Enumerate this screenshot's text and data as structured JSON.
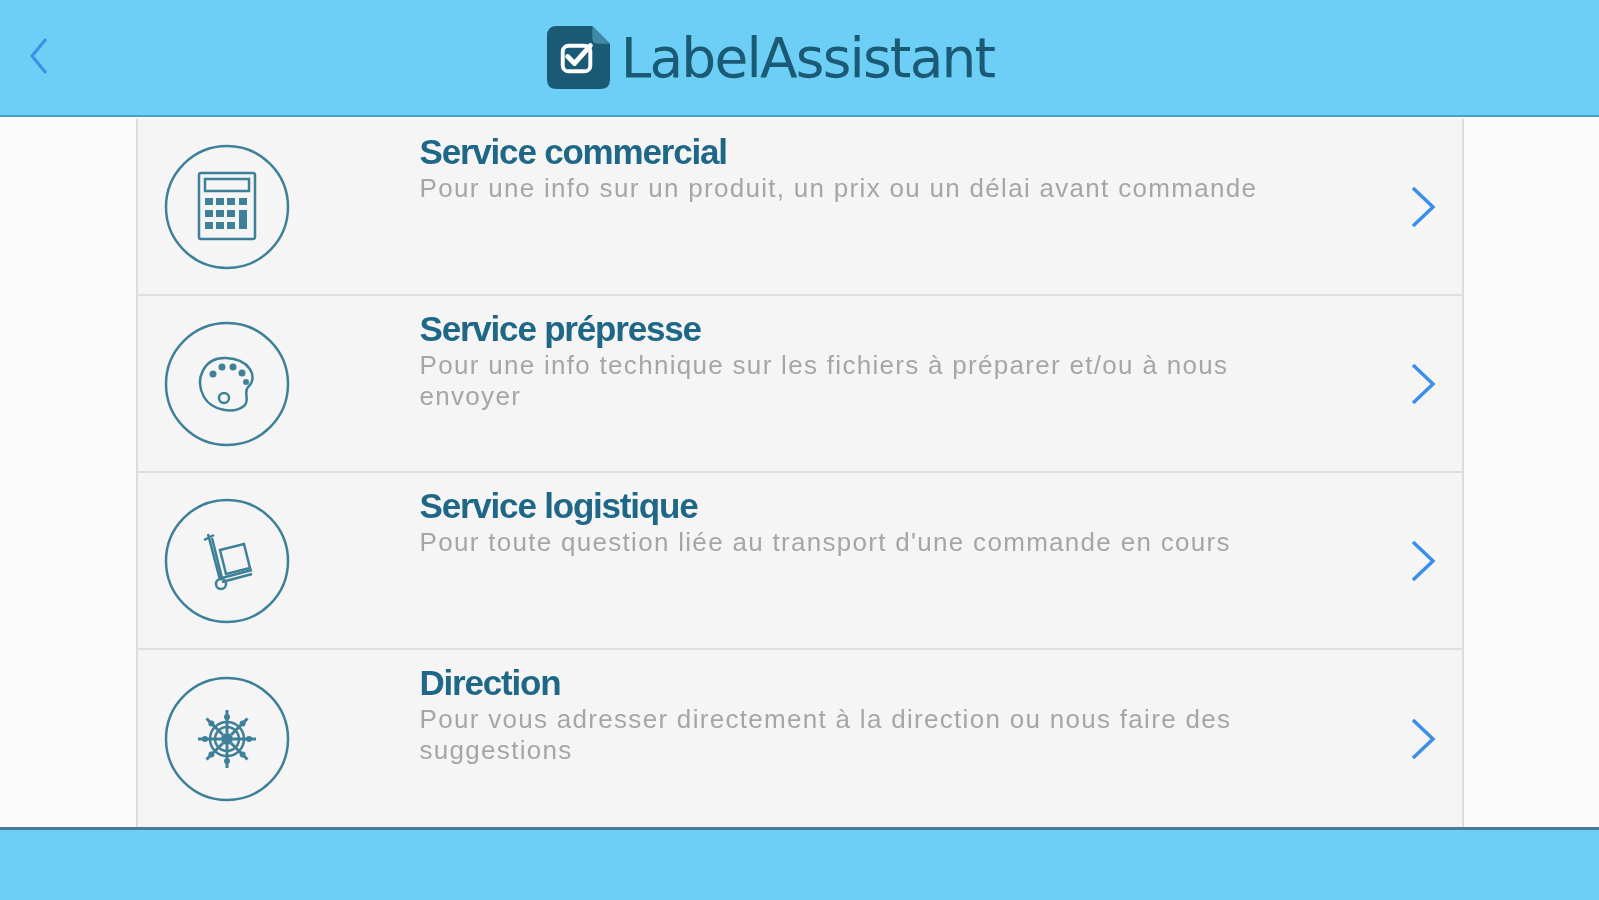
{
  "nav_bar": {
    "title": "LabelAssistant"
  },
  "services": [
    {
      "title": "Service commercial",
      "description": "Pour une info sur un produit, un prix ou un délai avant commande"
    },
    {
      "title": "Service prépresse",
      "description": "Pour une info technique sur les fichiers à préparer et/ou à nous envoyer"
    },
    {
      "title": "Service logistique",
      "description": "Pour toute question liée au transport d'une commande en cours"
    },
    {
      "title": "Direction",
      "description": "Pour vous adresser directement à la direction ou nous faire des suggestions"
    }
  ]
}
